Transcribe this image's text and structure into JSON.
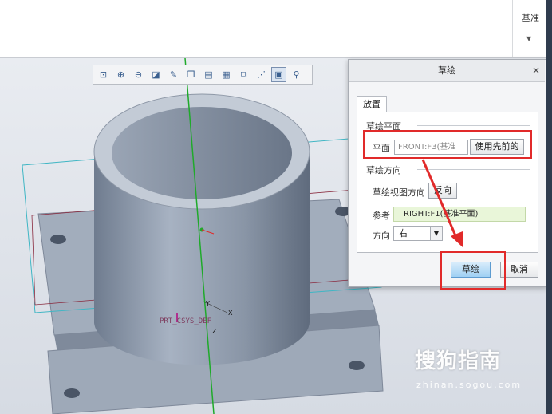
{
  "ribbon": {
    "group_label": "基准",
    "expand_icon": "dropdown-arrow-icon"
  },
  "view_toolbar": {
    "buttons": [
      {
        "name": "refit-icon",
        "glyph": "⊡"
      },
      {
        "name": "zoom-in-icon",
        "glyph": "⊕"
      },
      {
        "name": "zoom-out-icon",
        "glyph": "⊖"
      },
      {
        "name": "repaint-icon",
        "glyph": "◪"
      },
      {
        "name": "pan-icon",
        "glyph": "✎"
      },
      {
        "name": "display-style-icon",
        "glyph": "❒"
      },
      {
        "name": "saved-orientations-icon",
        "glyph": "▤"
      },
      {
        "name": "view-manager-icon",
        "glyph": "▦"
      },
      {
        "name": "perspective-icon",
        "glyph": "⧉"
      },
      {
        "name": "datum-display-icon",
        "glyph": "⋰"
      },
      {
        "name": "spin-center-icon",
        "glyph": "▣"
      },
      {
        "name": "annotation-display-icon",
        "glyph": "⚲"
      }
    ]
  },
  "model": {
    "csys_label": "PRT_CSYS_DEF",
    "axis_x": "X",
    "axis_y": "Y",
    "axis_z": "Z"
  },
  "dialog": {
    "title": "草绘",
    "close_icon": "×",
    "tab_label": "放置",
    "sketch_plane": {
      "group_label": "草绘平面",
      "plane_label": "平面",
      "plane_value": "FRONT:F3(基准",
      "use_previous_label": "使用先前的"
    },
    "orientation": {
      "group_label": "草绘方向",
      "view_direction_label": "草绘视图方向",
      "flip_label": "反向",
      "reference_label": "参考",
      "reference_value": "RIGHT:F1(基准平面)",
      "direction_label": "方向",
      "direction_value": "右"
    },
    "sketch_button": "草绘",
    "cancel_button": "取消"
  },
  "watermark": {
    "main": "搜狗指南",
    "sub": "zhinan.sogou.com"
  },
  "colors": {
    "highlight": "#e12a2a",
    "datum_axis": "#1faa2a",
    "model_body": "#8e9aab"
  }
}
